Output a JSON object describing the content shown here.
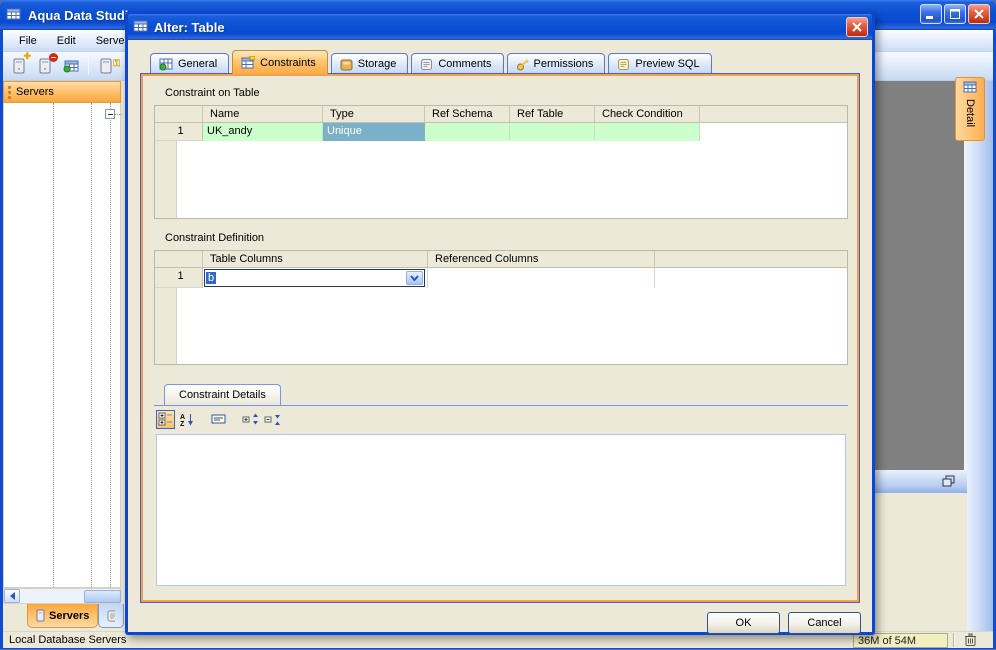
{
  "window": {
    "title": "Aqua Data Studi",
    "menu": {
      "items": [
        {
          "label": "File"
        },
        {
          "label": "Edit"
        },
        {
          "label": "Server"
        }
      ]
    },
    "toolbar_icons": [
      "register-server",
      "unregister-server",
      "open-table",
      "server-properties",
      "server-properties-remove"
    ],
    "servers_panel": {
      "header": "Servers",
      "bottom_tab": "Servers"
    },
    "detail_tab": "Detail",
    "status": {
      "left": "Local Database Servers",
      "memory": "36M of 54M"
    }
  },
  "dialog": {
    "title": "Alter: Table",
    "tabs": [
      {
        "label": "General",
        "icon": "table-general-icon",
        "active": false
      },
      {
        "label": "Constraints",
        "icon": "table-constraints-icon",
        "active": true
      },
      {
        "label": "Storage",
        "icon": "storage-icon",
        "active": false
      },
      {
        "label": "Comments",
        "icon": "comments-icon",
        "active": false
      },
      {
        "label": "Permissions",
        "icon": "permissions-icon",
        "active": false
      },
      {
        "label": "Preview SQL",
        "icon": "preview-sql-icon",
        "active": false
      }
    ],
    "constraint_on_table": {
      "label": "Constraint on Table",
      "columns": [
        "Name",
        "Type",
        "Ref Schema",
        "Ref Table",
        "Check Condition"
      ],
      "rows": [
        {
          "num": "1",
          "name": "UK_andy",
          "type": "Unique",
          "ref_schema": "",
          "ref_table": "",
          "check_condition": ""
        }
      ]
    },
    "constraint_definition": {
      "label": "Constraint Definition",
      "columns": [
        "Table Columns",
        "Referenced Columns"
      ],
      "rows": [
        {
          "num": "1",
          "table_columns": "b",
          "referenced_columns": ""
        }
      ]
    },
    "constraint_details": {
      "tab_label": "Constraint Details",
      "toolbar_icons": [
        "categorized",
        "sort-alphabetical",
        "property-pages",
        "expand-all",
        "collapse-all"
      ]
    },
    "buttons": {
      "ok": "OK",
      "cancel": "Cancel"
    }
  }
}
